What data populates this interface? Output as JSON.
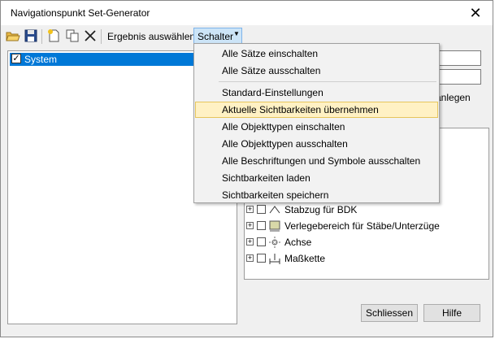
{
  "window": {
    "title": "Navigationspunkt Set-Generator",
    "close_glyph": "✕"
  },
  "toolbar": {
    "result_label": "Ergebnis auswählen",
    "schalter_label": "Schalter"
  },
  "tree": {
    "root_label": "System",
    "root_checked": true
  },
  "menu": {
    "items": [
      {
        "label": "Alle Sätze einschalten"
      },
      {
        "label": "Alle Sätze ausschalten"
      },
      {
        "label": "Standard-Einstellungen"
      },
      {
        "label": "Aktuelle Sichtbarkeiten übernehmen",
        "highlighted": true
      },
      {
        "label": "Alle Objekttypen einschalten"
      },
      {
        "label": "Alle Objekttypen ausschalten"
      },
      {
        "label": "Alle Beschriftungen und Symbole ausschalten"
      },
      {
        "label": "Sichtbarkeiten laden"
      },
      {
        "label": "Sichtbarkeiten speichern"
      }
    ]
  },
  "right_panel": {
    "partial_label": "anlegen",
    "object_types": [
      {
        "label": "Stabzug für BDK",
        "icon": "rebar-chain-icon"
      },
      {
        "label": "Verlegebereich für Stäbe/Unterzüge",
        "icon": "placement-area-icon"
      },
      {
        "label": "Achse",
        "icon": "axis-icon"
      },
      {
        "label": "Maßkette",
        "icon": "dimension-chain-icon"
      }
    ]
  },
  "buttons": {
    "close": "Schliessen",
    "help": "Hilfe"
  },
  "colors": {
    "selection": "#0078d7",
    "menu_highlight_bg": "#fff1c4",
    "menu_highlight_border": "#e6c55c",
    "pressed_button": "#cce4f7"
  }
}
